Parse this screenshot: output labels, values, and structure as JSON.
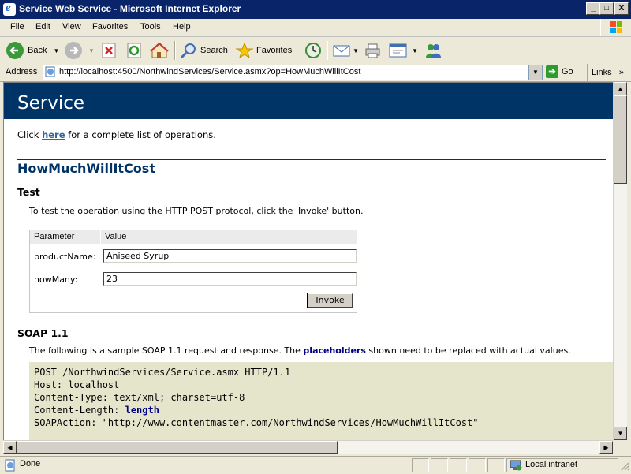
{
  "window": {
    "title": "Service Web Service - Microsoft Internet Explorer",
    "minimize": "_",
    "maximize": "□",
    "close": "X"
  },
  "menu": [
    "File",
    "Edit",
    "View",
    "Favorites",
    "Tools",
    "Help"
  ],
  "toolbar": {
    "back": "Back",
    "search": "Search",
    "favorites": "Favorites"
  },
  "address": {
    "label": "Address",
    "url": "http://localhost:4500/NorthwindServices/Service.asmx?op=HowMuchWillItCost",
    "go": "Go",
    "links": "Links",
    "links_chevron": "»"
  },
  "page": {
    "heading": "Service",
    "intro_prefix": "Click ",
    "intro_link": "here",
    "intro_suffix": " for a complete list of operations.",
    "operation": "HowMuchWillItCost",
    "test_heading": "Test",
    "test_text": "To test the operation using the HTTP POST protocol, click the 'Invoke' button.",
    "table": {
      "col_param": "Parameter",
      "col_value": "Value",
      "rows": [
        {
          "name": "productName:",
          "value": "Aniseed Syrup"
        },
        {
          "name": "howMany:",
          "value": "23"
        }
      ],
      "invoke": "Invoke"
    },
    "soap_heading": "SOAP 1.1",
    "soap_text_prefix": "The following is a sample SOAP 1.1 request and response. The ",
    "soap_text_bold": "placeholders",
    "soap_text_suffix": " shown need to be replaced with actual values.",
    "code": {
      "line1": "POST /NorthwindServices/Service.asmx HTTP/1.1",
      "line2": "Host: localhost",
      "line3": "Content-Type: text/xml; charset=utf-8",
      "line4_prefix": "Content-Length: ",
      "line4_bold": "length",
      "line5": "SOAPAction: \"http://www.contentmaster.com/NorthwindServices/HowMuchWillItCost\""
    }
  },
  "status": {
    "text": "Done",
    "zone": "Local intranet"
  }
}
